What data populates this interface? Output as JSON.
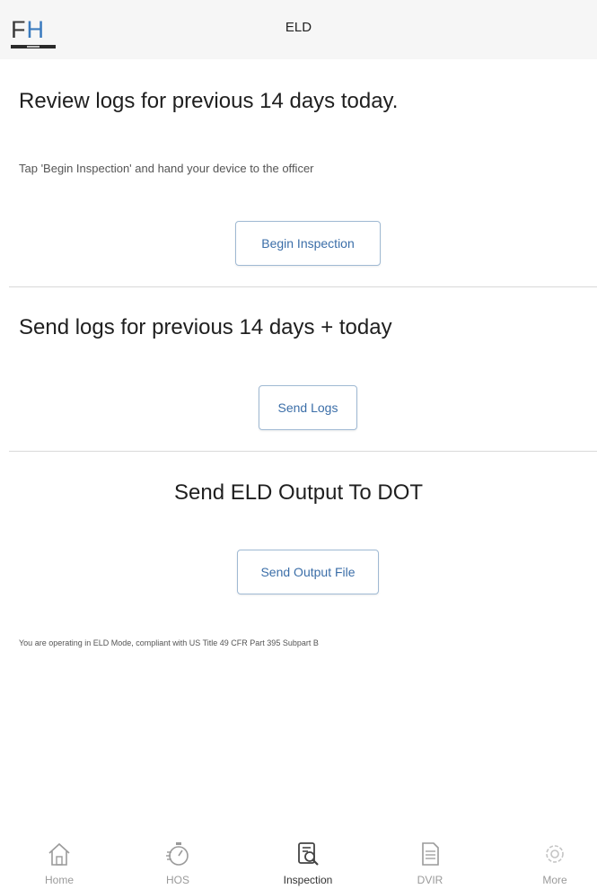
{
  "header": {
    "logo_text": "FH",
    "title": "ELD"
  },
  "review": {
    "heading": "Review logs for previous 14 days today.",
    "instruction": "Tap 'Begin Inspection' and hand your device to the officer",
    "button_label": "Begin Inspection"
  },
  "send": {
    "heading": "Send logs for previous 14 days + today",
    "button_label": "Send Logs"
  },
  "output": {
    "heading": "Send ELD Output To DOT",
    "button_label": "Send Output File"
  },
  "compliance_text": "You are operating in ELD Mode, compliant with US Title 49 CFR Part 395 Subpart B",
  "nav": {
    "active": "Inspection",
    "items": [
      {
        "label": "Home",
        "icon": "home-icon"
      },
      {
        "label": "HOS",
        "icon": "stopwatch-icon"
      },
      {
        "label": "Inspection",
        "icon": "inspection-icon"
      },
      {
        "label": "DVIR",
        "icon": "document-icon"
      },
      {
        "label": "More",
        "icon": "gear-icon"
      }
    ]
  },
  "colors": {
    "accent": "#3b6ea8",
    "logo_h": "#3b7bbf",
    "nav_inactive": "#9a9a9a",
    "nav_active": "#333333"
  }
}
